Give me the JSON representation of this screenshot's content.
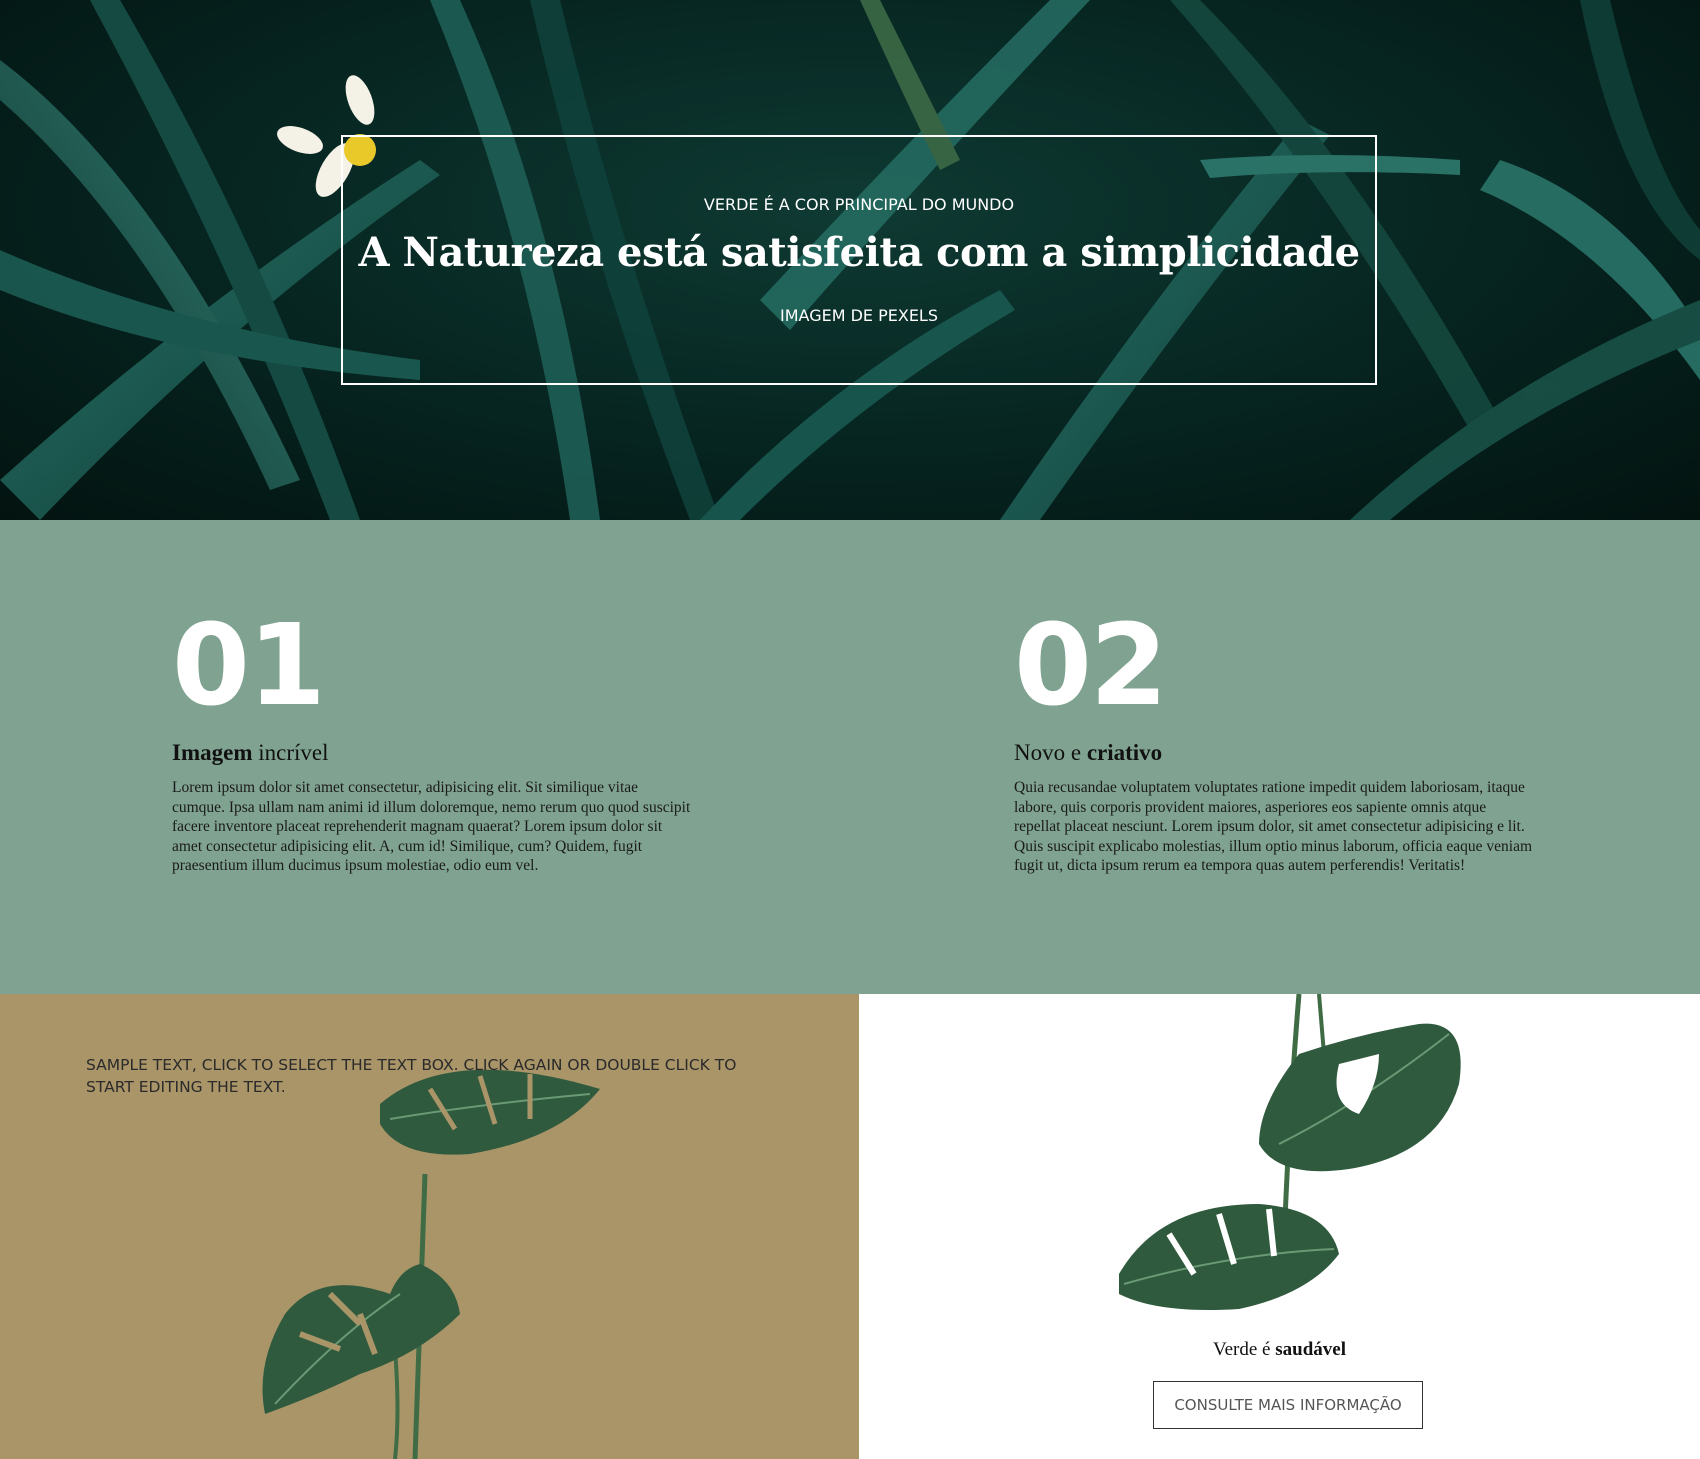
{
  "hero": {
    "kicker": "VERDE É A COR PRINCIPAL DO MUNDO",
    "title": "A Natureza está satisfeita com a simplicidade",
    "credit": "IMAGEM DE PEXELS"
  },
  "features": [
    {
      "number": "01",
      "heading_bold": "Imagem",
      "heading_regular": "incrível",
      "text": "Lorem ipsum dolor sit amet consectetur, adipisicing elit. Sit similique vitae cumque. Ipsa ullam nam animi id illum doloremque, nemo rerum quo quod suscipit facere inventore placeat reprehenderit magnam quaerat? Lorem ipsum dolor sit amet consectetur adipisicing elit. A, cum id! Similique, cum? Quidem, fugit praesentium illum ducimus ipsum molestiae, odio eum vel."
    },
    {
      "number": "02",
      "heading_regular": "Novo e",
      "heading_bold": "criativo",
      "text": "Quia recusandae voluptatem voluptates ratione impedit quidem laboriosam, itaque labore, quis corporis provident maiores, asperiores eos sapiente omnis atque repellat placeat nesciunt. Lorem ipsum dolor, sit amet consectetur adipisicing e lit. Quis suscipit explicabo molestias, illum optio minus laborum, officia eaque veniam fugit ut, dicta ipsum rerum ea tempora quas autem perferendis! Veritatis!"
    }
  ],
  "sample": {
    "text": "SAMPLE TEXT, CLICK TO SELECT THE TEXT BOX. CLICK AGAIN OR DOUBLE CLICK TO START EDITING THE TEXT."
  },
  "promo": {
    "caption_regular": "Verde é",
    "caption_bold": "saudável",
    "button_label": "CONSULTE MAIS INFORMAÇÃO"
  },
  "colors": {
    "features_bg": "#80a391",
    "sand_bg": "#aa9569",
    "leaf_green": "#2f5a3d"
  },
  "images": {
    "hero": "dark-green-leaves-photo",
    "left": "monstera-leaves-on-sand",
    "right": "hanging-monstera-leaves"
  }
}
